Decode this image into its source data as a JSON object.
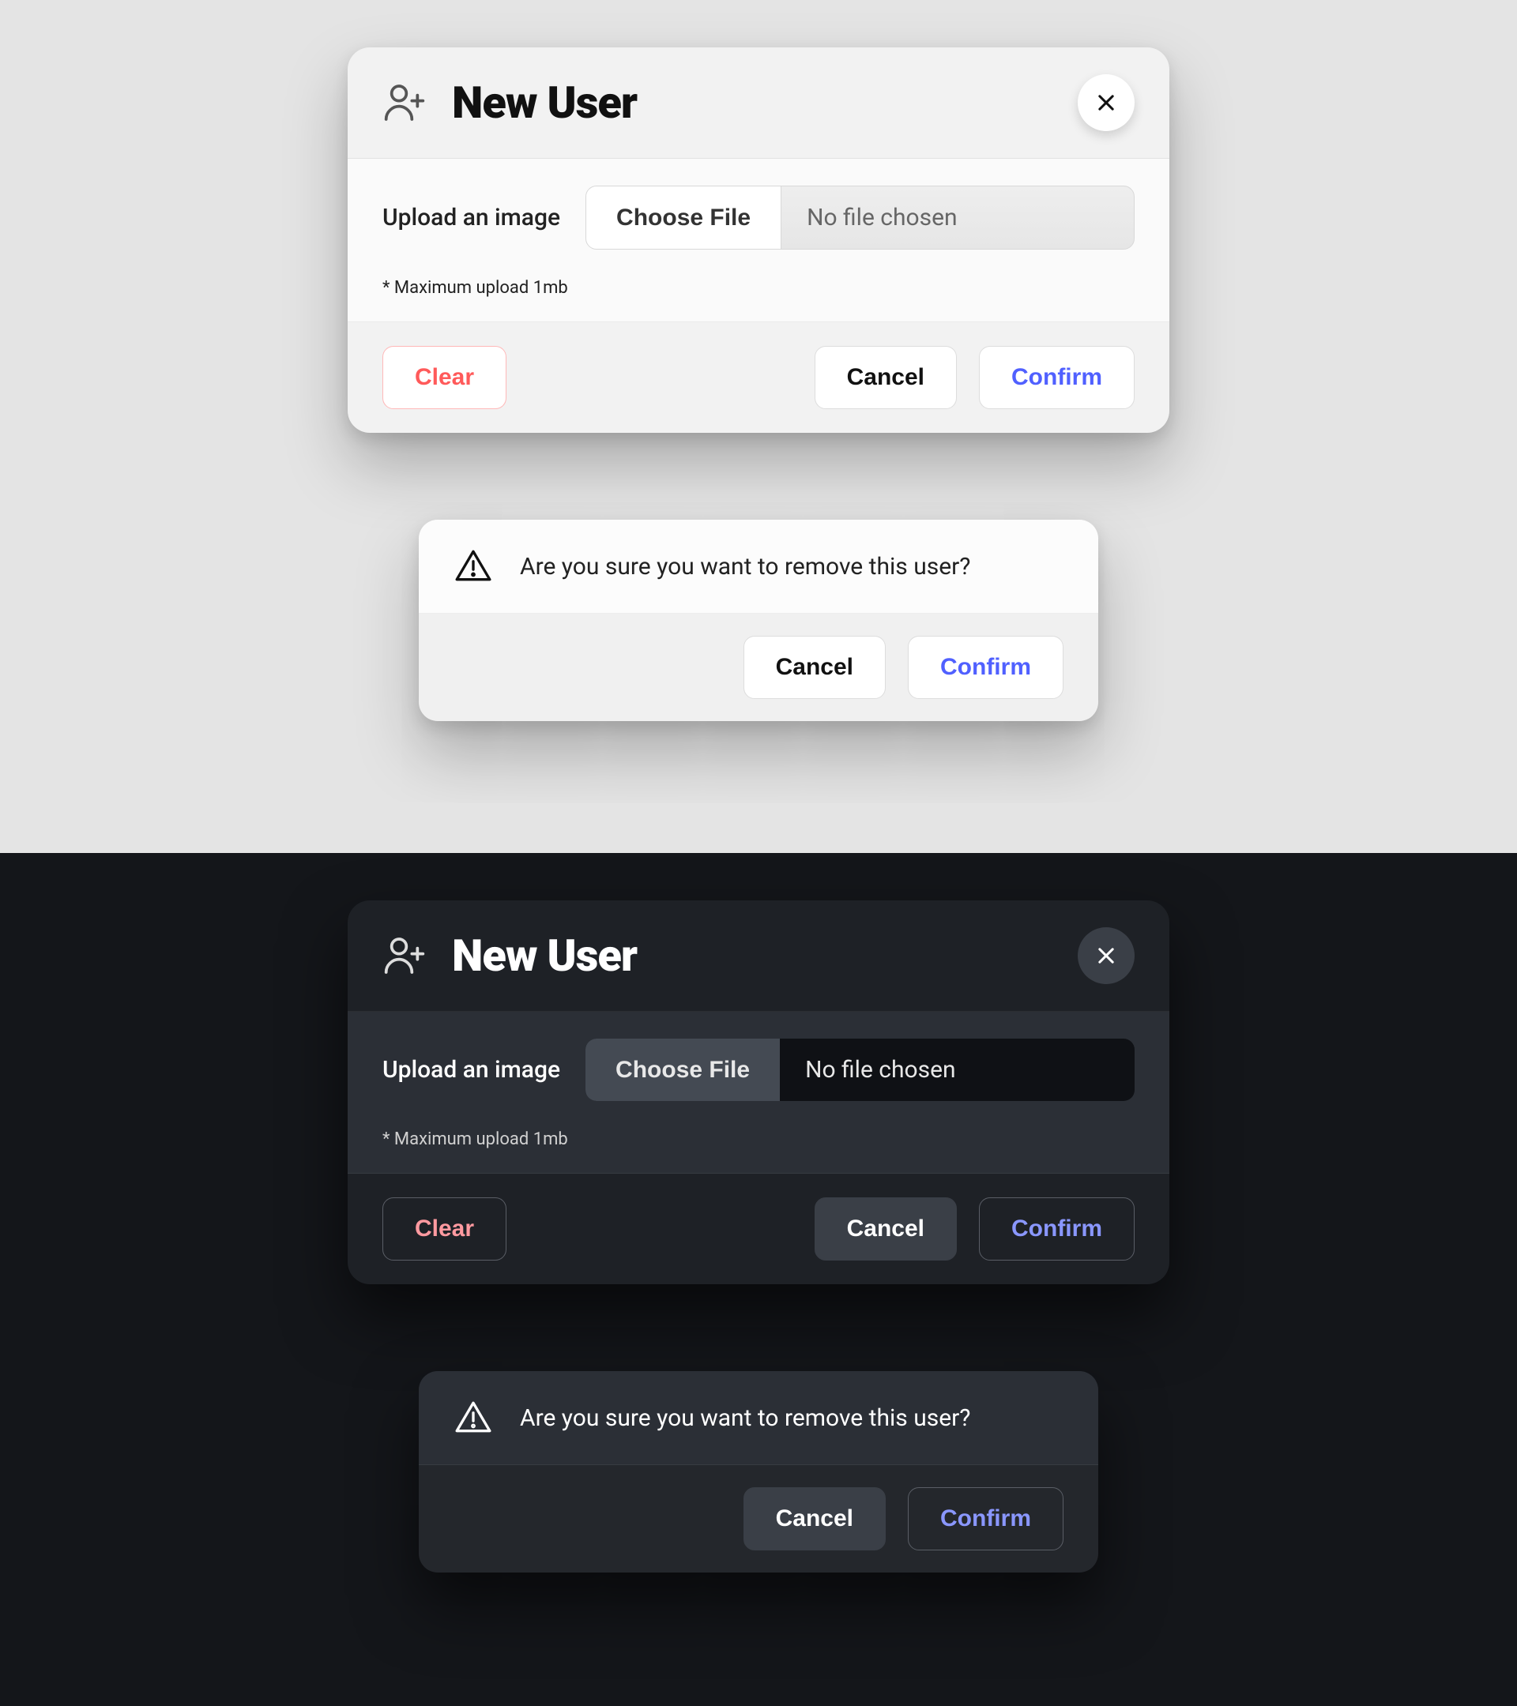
{
  "new_user_modal": {
    "title": "New User",
    "upload_label": "Upload an image",
    "choose_file_label": "Choose File",
    "file_status": "No file chosen",
    "hint": "* Maximum upload 1mb",
    "clear_label": "Clear",
    "cancel_label": "Cancel",
    "confirm_label": "Confirm"
  },
  "remove_user_alert": {
    "message": "Are you sure you want to remove this user?",
    "cancel_label": "Cancel",
    "confirm_label": "Confirm"
  },
  "colors": {
    "light_bg": "#e4e4e4",
    "dark_bg": "#14161a",
    "confirm_accent_light": "#5060ff",
    "confirm_accent_dark": "#8a97ff",
    "clear_accent_light": "#ff5a5a",
    "clear_accent_dark": "#ff9aa0"
  }
}
